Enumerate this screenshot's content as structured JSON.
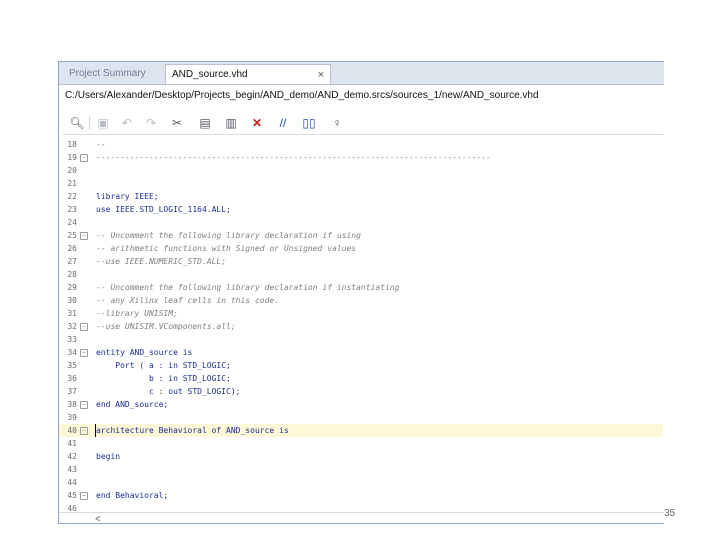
{
  "tabs": [
    {
      "label": "Project Summary",
      "close": "×",
      "active": false
    },
    {
      "label": "AND_source.vhd",
      "close": "×",
      "active": true
    }
  ],
  "file_path": "C:/Users/Alexander/Desktop/Projects_begin/AND_demo/AND_demo.srcs/sources_1/new/AND_source.vhd",
  "toolbar": {
    "icons": [
      "search-icon",
      "save-icon",
      "undo-icon",
      "redo-icon",
      "cut-icon",
      "copy-icon",
      "paste-icon",
      "delete-icon",
      "comment-toggle-icon",
      "split-view-icon",
      "lightbulb-icon"
    ]
  },
  "lines": [
    {
      "n": "18",
      "fold": false,
      "text": "--",
      "cls": "cm"
    },
    {
      "n": "19",
      "fold": true,
      "text": "----------------------------------------------------------------------------------",
      "cls": "cm"
    },
    {
      "n": "20",
      "fold": false,
      "text": "",
      "cls": "nm"
    },
    {
      "n": "21",
      "fold": false,
      "text": "",
      "cls": "nm"
    },
    {
      "n": "22",
      "fold": false,
      "text": "library IEEE;",
      "cls": "kw"
    },
    {
      "n": "23",
      "fold": false,
      "text": "use IEEE.STD_LOGIC_1164.ALL;",
      "cls": "kw"
    },
    {
      "n": "24",
      "fold": false,
      "text": "",
      "cls": "nm"
    },
    {
      "n": "25",
      "fold": true,
      "text": "-- Uncomment the following library declaration if using",
      "cls": "cm"
    },
    {
      "n": "26",
      "fold": false,
      "text": "-- arithmetic functions with Signed or Unsigned values",
      "cls": "cm"
    },
    {
      "n": "27",
      "fold": false,
      "text": "--use IEEE.NUMERIC_STD.ALL;",
      "cls": "cm"
    },
    {
      "n": "28",
      "fold": false,
      "text": "",
      "cls": "nm"
    },
    {
      "n": "29",
      "fold": false,
      "text": "-- Uncomment the following library declaration if instantiating",
      "cls": "cm"
    },
    {
      "n": "30",
      "fold": false,
      "text": "-- any Xilinx leaf cells in this code.",
      "cls": "cm"
    },
    {
      "n": "31",
      "fold": false,
      "text": "--library UNISIM;",
      "cls": "cm"
    },
    {
      "n": "32",
      "fold": true,
      "text": "--use UNISIM.VComponents.all;",
      "cls": "cm"
    },
    {
      "n": "33",
      "fold": false,
      "text": "",
      "cls": "nm"
    },
    {
      "n": "34",
      "fold": true,
      "text": "entity AND_source is",
      "cls": "kw"
    },
    {
      "n": "35",
      "fold": false,
      "text": "    Port ( a : in STD_LOGIC;",
      "cls": "kw"
    },
    {
      "n": "36",
      "fold": false,
      "text": "           b : in STD_LOGIC;",
      "cls": "kw"
    },
    {
      "n": "37",
      "fold": false,
      "text": "           c : out STD_LOGIC);",
      "cls": "kw"
    },
    {
      "n": "38",
      "fold": true,
      "text": "end AND_source;",
      "cls": "kw"
    },
    {
      "n": "39",
      "fold": false,
      "text": "",
      "cls": "nm"
    },
    {
      "n": "40",
      "fold": true,
      "text": "architecture Behavioral of AND_source is",
      "cls": "kw",
      "highlight": true
    },
    {
      "n": "41",
      "fold": false,
      "text": "",
      "cls": "nm"
    },
    {
      "n": "42",
      "fold": false,
      "text": "begin",
      "cls": "kw"
    },
    {
      "n": "43",
      "fold": false,
      "text": "",
      "cls": "nm"
    },
    {
      "n": "44",
      "fold": false,
      "text": "",
      "cls": "nm"
    },
    {
      "n": "45",
      "fold": true,
      "text": "end Behavioral;",
      "cls": "kw"
    },
    {
      "n": "46",
      "fold": false,
      "text": "",
      "cls": "nm"
    }
  ],
  "scroll_left": "<",
  "page_number": "35"
}
